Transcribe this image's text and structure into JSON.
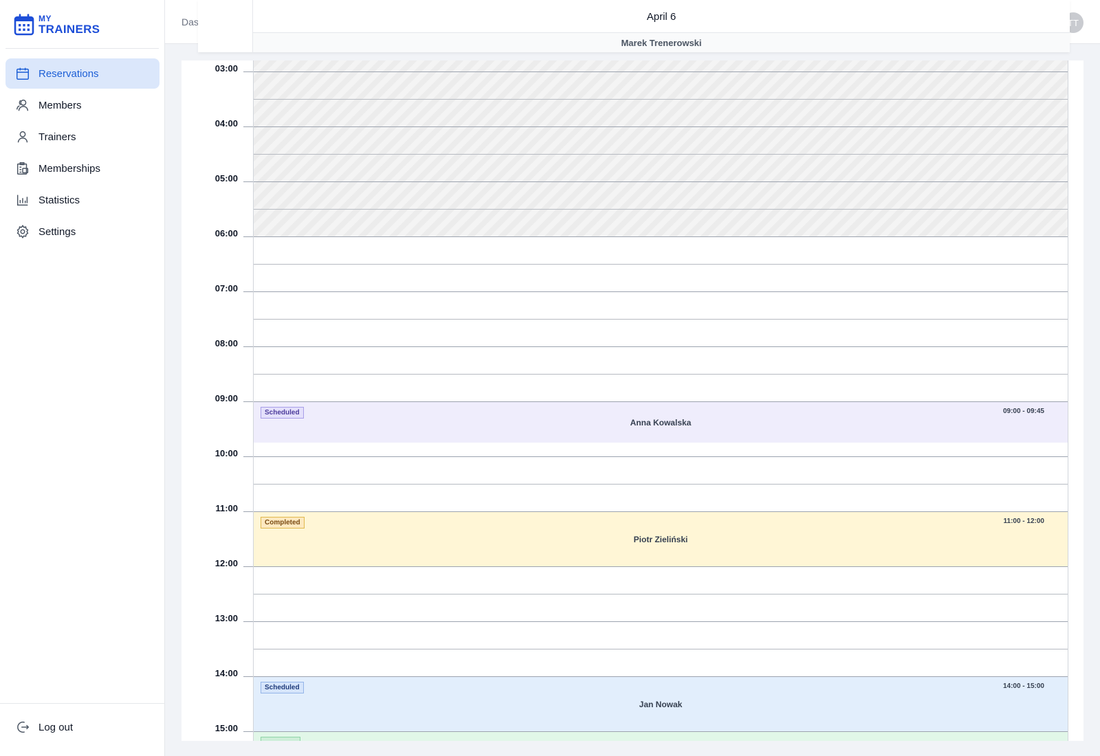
{
  "app": {
    "logo_small": "MY",
    "logo_big": "TRAINERS"
  },
  "sidebar": {
    "items": [
      {
        "label": "Reservations",
        "icon": "calendar-icon",
        "active": true
      },
      {
        "label": "Members",
        "icon": "members-icon"
      },
      {
        "label": "Trainers",
        "icon": "user-icon"
      },
      {
        "label": "Memberships",
        "icon": "memberships-icon"
      },
      {
        "label": "Statistics",
        "icon": "chart-icon"
      },
      {
        "label": "Settings",
        "icon": "gear-icon"
      }
    ],
    "logout_label": "Log out"
  },
  "header": {
    "breadcrumb": "Das",
    "avatar_initials": "TT"
  },
  "calendar": {
    "date": "April 6",
    "trainer": "Marek Trenerowski",
    "hours": [
      "03:00",
      "04:00",
      "05:00",
      "06:00",
      "07:00",
      "08:00",
      "09:00",
      "10:00",
      "11:00",
      "12:00",
      "13:00",
      "14:00",
      "15:00"
    ],
    "unavailable_until": "06:00",
    "events": [
      {
        "status": "Scheduled",
        "time": "09:00 - 09:45",
        "member": "Anna Kowalska",
        "bg": "#efedfc",
        "badge_bg": "#e4e0fb",
        "badge_border": "#a89ee8",
        "badge_color": "#4c3c9c"
      },
      {
        "status": "Completed",
        "time": "11:00 - 12:00",
        "member": "Piotr Zieliński",
        "bg": "#fff6d6",
        "badge_bg": "#fde9c0",
        "badge_border": "#e0b84c",
        "badge_color": "#7a4b12"
      },
      {
        "status": "Scheduled",
        "time": "14:00 - 15:00",
        "member": "Jan Nowak",
        "bg": "#e2eefc",
        "badge_bg": "#d6e5fb",
        "badge_border": "#93b4e8",
        "badge_color": "#1e3a7a"
      },
      {
        "status": "",
        "time": "",
        "member": "",
        "bg": "#e1f7e8",
        "badge_bg": "#cdeed8",
        "badge_border": "#8fd3a6",
        "badge_color": "#1d6b3b"
      }
    ]
  }
}
